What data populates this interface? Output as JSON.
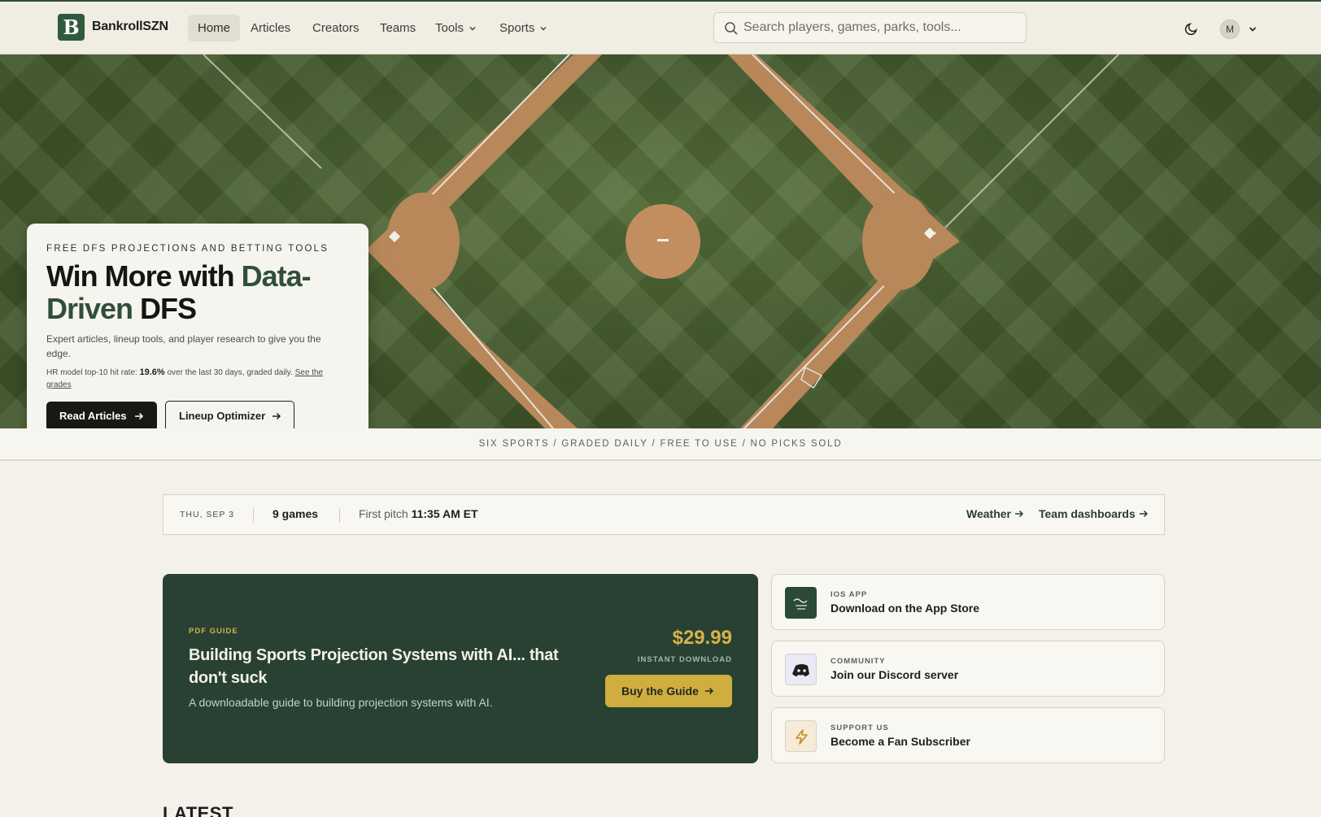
{
  "brand": {
    "name": "BankrollSZN",
    "logo_letter": "B"
  },
  "nav": {
    "items": [
      {
        "label": "Home",
        "active": true
      },
      {
        "label": "Articles"
      },
      {
        "label": "Creators"
      },
      {
        "label": "Teams"
      },
      {
        "label": "Tools",
        "has_dropdown": true
      },
      {
        "label": "Sports",
        "has_dropdown": true
      }
    ],
    "search_placeholder": "Search players, games, parks, tools...",
    "avatar_initial": "M"
  },
  "hero": {
    "eyebrow": "FREE DFS PROJECTIONS AND BETTING TOOLS",
    "title_part1": "Win More with ",
    "title_highlight1": "Data-Driven",
    "title_part2": " DFS",
    "description": "Expert articles, lineup tools, and player research to give you the edge.",
    "stat_prefix": "HR model top-10 hit rate: ",
    "stat_value": "19.6%",
    "stat_suffix": " over the last 30 days, graded daily. ",
    "stat_link": "See the grades",
    "primary_button": "Read Articles",
    "secondary_button": "Lineup Optimizer"
  },
  "ticker": "SIX SPORTS / GRADED DAILY / FREE TO USE / NO PICKS SOLD",
  "slate": {
    "date": "THU, SEP 3",
    "games": "9 games",
    "first_pitch_label": "First pitch ",
    "first_pitch_time": "11:35 AM ET",
    "links": [
      "Weather",
      "Team dashboards"
    ]
  },
  "guide": {
    "eyebrow": "PDF GUIDE",
    "title": "Building Sports Projection Systems with AI... that don't suck",
    "description": "A downloadable guide to building projection systems with AI.",
    "price": "$29.99",
    "price_note": "INSTANT DOWNLOAD",
    "button": "Buy the Guide"
  },
  "side_cards": [
    {
      "eyebrow": "IOS APP",
      "title": "Download on the App Store",
      "icon": "app-logo-icon"
    },
    {
      "eyebrow": "COMMUNITY",
      "title": "Join our Discord server",
      "icon": "discord-icon"
    },
    {
      "eyebrow": "SUPPORT US",
      "title": "Become a Fan Subscriber",
      "icon": "lightning-icon"
    }
  ],
  "section_heading": "LATEST",
  "colors": {
    "brand_green": "#2f5a3c",
    "guide_bg": "#284133",
    "gold": "#d0ad3f",
    "discord": "#5865f2"
  }
}
